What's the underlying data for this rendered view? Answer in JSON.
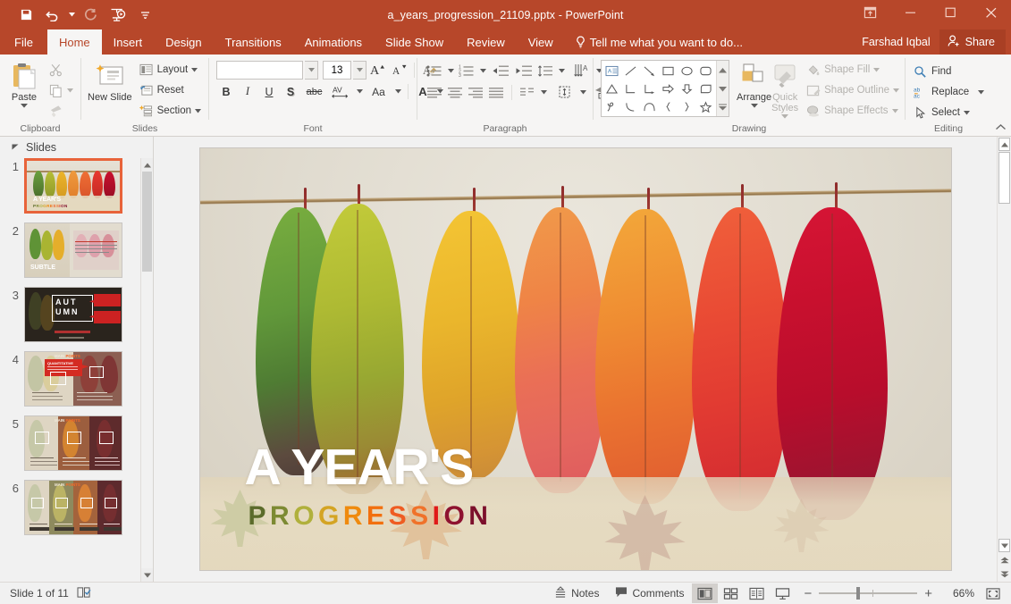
{
  "titlebar": {
    "document_title": "a_years_progression_21109.pptx - PowerPoint",
    "qat": [
      {
        "name": "save",
        "label": "Save"
      },
      {
        "name": "undo",
        "label": "Undo"
      },
      {
        "name": "redo",
        "label": "Redo"
      },
      {
        "name": "start-presentation",
        "label": "Start From Beginning"
      },
      {
        "name": "customize-qat",
        "label": "Customize Quick Access Toolbar"
      }
    ],
    "window_controls": [
      {
        "name": "ribbon-display-options",
        "label": "Ribbon Display Options"
      },
      {
        "name": "minimize",
        "label": "Minimize"
      },
      {
        "name": "restore",
        "label": "Restore Down"
      },
      {
        "name": "close",
        "label": "Close"
      }
    ]
  },
  "tabs": [
    {
      "label": "File",
      "active": false
    },
    {
      "label": "Home",
      "active": true
    },
    {
      "label": "Insert",
      "active": false
    },
    {
      "label": "Design",
      "active": false
    },
    {
      "label": "Transitions",
      "active": false
    },
    {
      "label": "Animations",
      "active": false
    },
    {
      "label": "Slide Show",
      "active": false
    },
    {
      "label": "Review",
      "active": false
    },
    {
      "label": "View",
      "active": false
    }
  ],
  "tellme": {
    "placeholder": "Tell me what you want to do..."
  },
  "account": {
    "user_name": "Farshad Iqbal",
    "share_label": "Share"
  },
  "ribbon": {
    "clipboard": {
      "group_label": "Clipboard",
      "paste_label": "Paste",
      "cut_label": "Cut",
      "copy_label": "Copy",
      "format_painter_label": "Format Painter"
    },
    "slides": {
      "group_label": "Slides",
      "new_slide_label": "New Slide",
      "layout_label": "Layout",
      "reset_label": "Reset",
      "section_label": "Section"
    },
    "font": {
      "group_label": "Font",
      "font_name": "",
      "font_name_placeholder": "",
      "font_size": "13",
      "bold_label": "B",
      "italic_label": "I",
      "underline_label": "U",
      "shadow_label": "S",
      "strikethrough_label": "abc",
      "char_spacing_label": "AV",
      "change_case_label": "Aa",
      "font_color_label": "A"
    },
    "paragraph": {
      "group_label": "Paragraph"
    },
    "drawing": {
      "group_label": "Drawing",
      "arrange_label": "Arrange",
      "quick_styles_label": "Quick Styles",
      "shape_fill_label": "Shape Fill",
      "shape_outline_label": "Shape Outline",
      "shape_effects_label": "Shape Effects"
    },
    "editing": {
      "group_label": "Editing",
      "find_label": "Find",
      "replace_label": "Replace",
      "select_label": "Select"
    }
  },
  "slide_panel": {
    "header_label": "Slides",
    "thumbnails": [
      {
        "number": "1",
        "selected": true,
        "has_animation": true
      },
      {
        "number": "2",
        "selected": false,
        "has_animation": false
      },
      {
        "number": "3",
        "selected": false,
        "has_animation": false
      },
      {
        "number": "4",
        "selected": false,
        "has_animation": false
      },
      {
        "number": "5",
        "selected": false,
        "has_animation": false
      },
      {
        "number": "6",
        "selected": false,
        "has_animation": false
      }
    ]
  },
  "slide": {
    "title": "A YEAR'S",
    "subtitle_letters": [
      {
        "ch": "P",
        "color": "#5b6b2b"
      },
      {
        "ch": "R",
        "color": "#7d8a33"
      },
      {
        "ch": "O",
        "color": "#b0b03c"
      },
      {
        "ch": "G",
        "color": "#d4a423"
      },
      {
        "ch": "R",
        "color": "#ef8a0e"
      },
      {
        "ch": "E",
        "color": "#f2700f"
      },
      {
        "ch": "S",
        "color": "#ef5c22"
      },
      {
        "ch": "S",
        "color": "#f0722a"
      },
      {
        "ch": "I",
        "color": "#e01a18"
      },
      {
        "ch": "O",
        "color": "#8e1230"
      },
      {
        "ch": "N",
        "color": "#7c0f2c"
      }
    ],
    "leaf_colors": [
      "#5e9638",
      "#a8b532",
      "#e8b128",
      "#ef8f3c",
      "#ef6a34",
      "#e8382f",
      "#c8102e"
    ]
  },
  "statusbar": {
    "slide_indicator": "Slide 1 of 11",
    "spellcheck_label": "Spelling check",
    "notes_label": "Notes",
    "comments_label": "Comments",
    "views": [
      {
        "name": "normal-view",
        "active": true
      },
      {
        "name": "slide-sorter-view",
        "active": false
      },
      {
        "name": "reading-view",
        "active": false
      },
      {
        "name": "slide-show-view",
        "active": false
      }
    ],
    "zoom_out_label": "−",
    "zoom_in_label": "+",
    "zoom_percent": "66%",
    "fit_label": "Fit slide to current window"
  }
}
